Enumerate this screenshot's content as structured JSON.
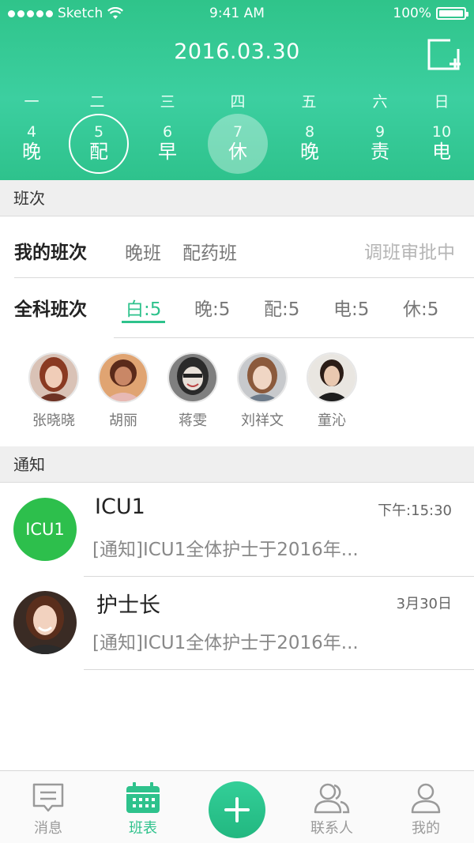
{
  "status_bar": {
    "carrier": "Sketch",
    "time": "9:41 AM",
    "battery": "100%"
  },
  "header": {
    "date": "2016.03.30",
    "weekdays": [
      "一",
      "二",
      "三",
      "四",
      "五",
      "六",
      "日"
    ],
    "days": [
      {
        "num": "4",
        "shift": "晚"
      },
      {
        "num": "5",
        "shift": "配"
      },
      {
        "num": "6",
        "shift": "早"
      },
      {
        "num": "7",
        "shift": "休"
      },
      {
        "num": "8",
        "shift": "晚"
      },
      {
        "num": "9",
        "shift": "责"
      },
      {
        "num": "10",
        "shift": "电"
      }
    ]
  },
  "shift_section": {
    "title": "班次"
  },
  "my_shift": {
    "label": "我的班次",
    "items": [
      "晚班",
      "配药班"
    ],
    "pending": "调班审批中"
  },
  "all_shift": {
    "label": "全科班次",
    "tabs": [
      "白:5",
      "晚:5",
      "配:5",
      "电:5",
      "休:5"
    ]
  },
  "people": [
    "张晓晓",
    "胡丽",
    "蒋雯",
    "刘祥文",
    "童沁"
  ],
  "notice_section": {
    "title": "通知"
  },
  "notices": [
    {
      "badge": "ICU1",
      "title": "ICU1",
      "time": "下午:15:30",
      "body": "[通知]ICU1全体护士于2016年..."
    },
    {
      "title": "护士长",
      "time": "3月30日",
      "body": "[通知]ICU1全体护士于2016年..."
    }
  ],
  "tabbar": {
    "messages": "消息",
    "schedule": "班表",
    "contacts": "联系人",
    "me": "我的"
  },
  "colors": {
    "accent": "#2ec28c",
    "badge": "#2dbf4c"
  }
}
